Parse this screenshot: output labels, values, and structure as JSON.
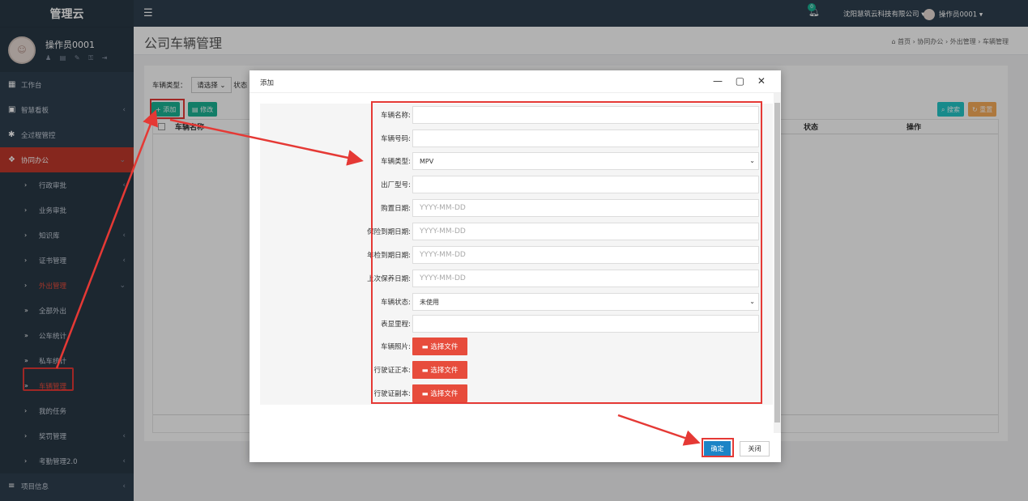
{
  "app": {
    "title": "管理云"
  },
  "profile": {
    "name": "操作员0001",
    "icons": "♟ ▤ ✎ ⚿ ⇥"
  },
  "topbar": {
    "bell_count": "0",
    "company": "沈阳慧筑云科技有限公司 ▾",
    "user": "操作员0001 ▾"
  },
  "menu": [
    {
      "icon": "▦",
      "label": "工作台",
      "chev": ""
    },
    {
      "icon": "▣",
      "label": "智慧看板",
      "chev": "‹"
    },
    {
      "icon": "✱",
      "label": "全过程管控",
      "chev": ""
    },
    {
      "icon": "❖",
      "label": "协同办公",
      "chev": "⌄"
    }
  ],
  "submenu": [
    {
      "icon": "›",
      "label": "行政审批",
      "chev": "‹"
    },
    {
      "icon": "›",
      "label": "业务审批",
      "chev": ""
    },
    {
      "icon": "›",
      "label": "知识库",
      "chev": "‹"
    },
    {
      "icon": "›",
      "label": "证书管理",
      "chev": "‹"
    },
    {
      "icon": "›",
      "label": "外出管理",
      "chev": "⌄"
    },
    {
      "icon": "»",
      "label": "全部外出",
      "chev": ""
    },
    {
      "icon": "»",
      "label": "公车统计",
      "chev": ""
    },
    {
      "icon": "»",
      "label": "私车统计",
      "chev": ""
    },
    {
      "icon": "»",
      "label": "车辆管理",
      "chev": ""
    },
    {
      "icon": "›",
      "label": "我的任务",
      "chev": ""
    },
    {
      "icon": "›",
      "label": "奖罚管理",
      "chev": "‹"
    },
    {
      "icon": "›",
      "label": "考勤管理2.0",
      "chev": "‹"
    }
  ],
  "menu_bottom": {
    "icon": "≡",
    "label": "项目信息",
    "chev": "‹"
  },
  "page": {
    "title": "公司车辆管理",
    "breadcrumb": "⌂ 首页 › 协同办公 › 外出管理 › 车辆管理"
  },
  "filter": {
    "label": "车辆类型：",
    "select": "请选择 ⌄",
    "label2": "状态"
  },
  "toolbar": {
    "add": "+ 添加",
    "edit": "▤ 修改",
    "search": "⌕ 搜索",
    "reset": "↻ 重置"
  },
  "table": {
    "col_name": "车辆名称",
    "col_status": "状态",
    "col_action": "操作"
  },
  "modal": {
    "title": "添加",
    "controls": "— ▢ ✕",
    "fields": [
      {
        "label": "车辆名称:",
        "value": ""
      },
      {
        "label": "车辆号码:",
        "value": ""
      },
      {
        "label": "车辆类型:",
        "value": "MPV"
      },
      {
        "label": "出厂型号:",
        "value": ""
      },
      {
        "label": "购置日期:",
        "value": "YYYY-MM-DD"
      },
      {
        "label": "保险到期日期:",
        "value": "YYYY-MM-DD"
      },
      {
        "label": "年检到期日期:",
        "value": "YYYY-MM-DD"
      },
      {
        "label": "上次保养日期:",
        "value": "YYYY-MM-DD"
      },
      {
        "label": "车辆状态:",
        "value": "未使用"
      },
      {
        "label": "表显里程:",
        "value": ""
      },
      {
        "label": "车辆照片:",
        "button": "▬ 选择文件"
      },
      {
        "label": "行驶证正本:",
        "button": "▬ 选择文件"
      },
      {
        "label": "行驶证副本:",
        "button": "▬ 选择文件"
      }
    ],
    "confirm": "确定",
    "close": "关闭"
  },
  "colors": {
    "sidebar": "#2f4050",
    "active": "#c0392b",
    "primary": "#1ab394",
    "highlight": "#e53935"
  }
}
